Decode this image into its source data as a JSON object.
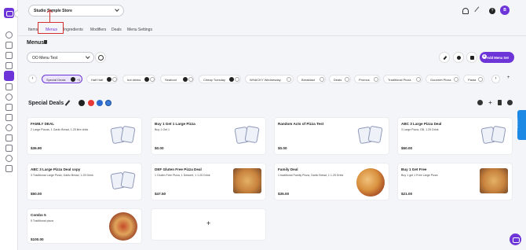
{
  "store": {
    "name": "Studio Sample Store"
  },
  "user": {
    "initial": "B"
  },
  "tabs": [
    {
      "label": "Items",
      "active": false
    },
    {
      "label": "Menus",
      "active": true
    },
    {
      "label": "Ingredients",
      "active": false
    },
    {
      "label": "Modifiers",
      "active": false
    },
    {
      "label": "Deals",
      "active": false
    },
    {
      "label": "Menu Settings",
      "active": false
    }
  ],
  "page": {
    "title": "Menus"
  },
  "menu_select": {
    "value": "OO Menu Test"
  },
  "add_menu": {
    "label": "Add Menu Set"
  },
  "categories": [
    {
      "label": "Special Deals",
      "active": true,
      "count": "+3"
    },
    {
      "label": "Half Half"
    },
    {
      "label": "hot drinks"
    },
    {
      "label": "Seafood"
    },
    {
      "label": "Cheap Tuesday"
    },
    {
      "label": "WHACKY Wednesday"
    },
    {
      "label": "Breakfast"
    },
    {
      "label": "Deals"
    },
    {
      "label": "Promos"
    },
    {
      "label": "Traditional Pizza"
    },
    {
      "label": "Gourmet Pizza"
    },
    {
      "label": "Pasta"
    }
  ],
  "section": {
    "title": "Special Deals"
  },
  "cards": [
    {
      "name": "FAMILY DEAL",
      "desc": "2 Large Pizzas, 1 Garlic Bread, 1.25 litre drink",
      "price": "$36.90",
      "image": "placeholder"
    },
    {
      "name": "Buy 1 Get 1 Large Pizza",
      "desc": "Buy 1 Get 1",
      "price": "$0.00",
      "image": "placeholder"
    },
    {
      "name": "Random Acts of Pizza Test",
      "desc": "",
      "price": "$0.00",
      "image": "placeholder"
    },
    {
      "name": "ABC 3 Large Pizza Deal",
      "desc": "3 Large Pizza, GB, 1.25 Drink",
      "price": "$50.00",
      "image": "placeholder"
    },
    {
      "name": "ABC 3 Large Pizza Deal copy",
      "desc": "3 Traditional Large Pizza, Garlic Bread, 1.25 Drink",
      "price": "$50.00",
      "image": "placeholder"
    },
    {
      "name": "DEF Gluten Free Pizza Deal",
      "desc": "1 Gluten Free Pizza, 1 Dessert, 1 1.25 Drink",
      "price": "$47.50",
      "image": "pizza-pan"
    },
    {
      "name": "Family Deal",
      "desc": "1 traditional Family Pizza, Garlic Bread, 1 1.25 Drink",
      "price": "$35.00",
      "image": "pizza"
    },
    {
      "name": "Buy 1 Get Free",
      "desc": "Buy 1 get 1 Free Large Pizza",
      "price": "$21.00",
      "image": "pizza-pan"
    },
    {
      "name": "Combo 5",
      "desc": "5 Traditional pizza",
      "price": "$100.00",
      "image": "pizza-dark"
    }
  ],
  "add_card": {
    "symbol": "+"
  },
  "feedback": {
    "label": "Feedback"
  },
  "colors": {
    "accent": "#6d35d8",
    "highlight": "#d32f2f",
    "feedback": "#1e88e5"
  }
}
